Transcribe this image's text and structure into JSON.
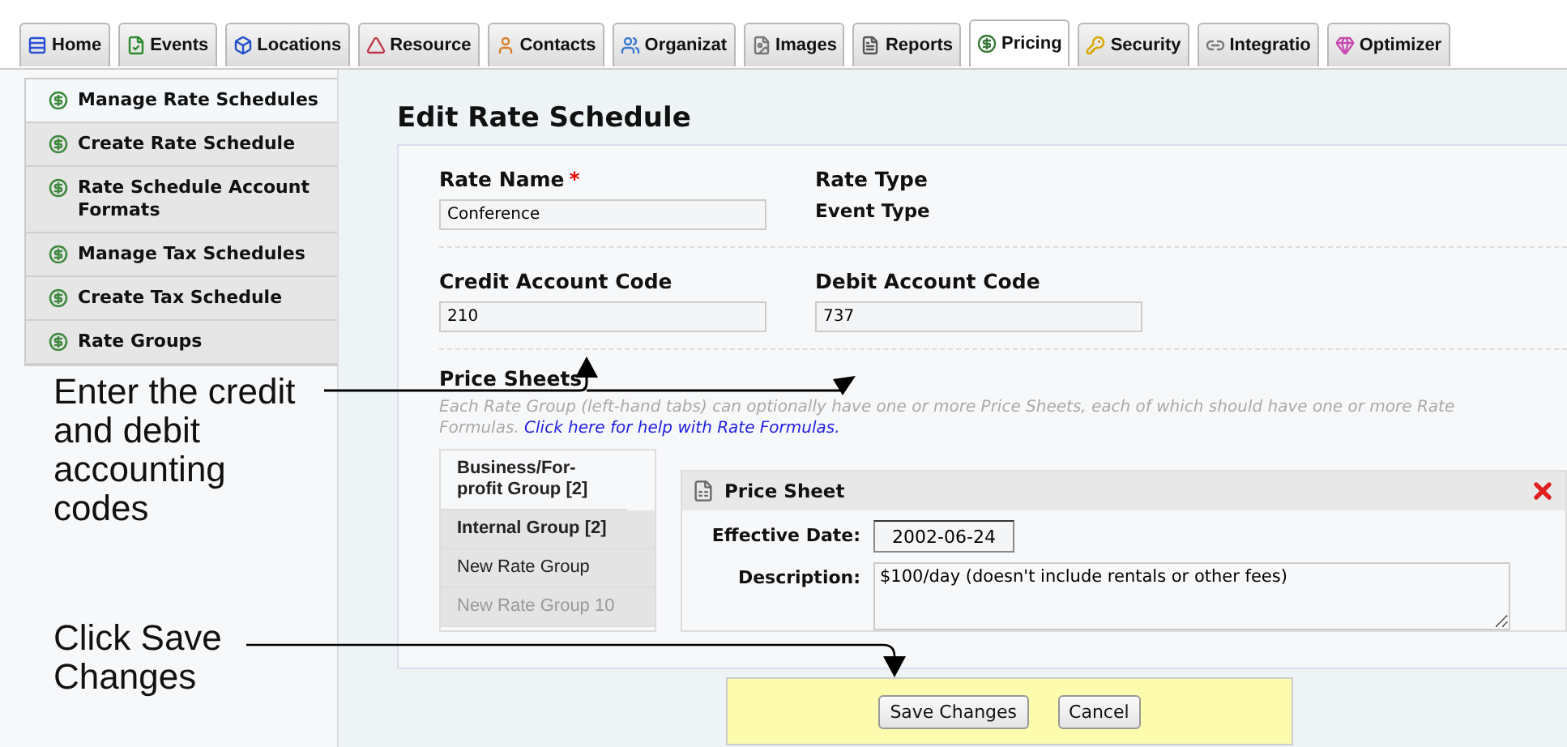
{
  "tabs": [
    {
      "label": "Home",
      "selected": false
    },
    {
      "label": "Events",
      "selected": false
    },
    {
      "label": "Locations",
      "selected": false
    },
    {
      "label": "Resource",
      "selected": false
    },
    {
      "label": "Contacts",
      "selected": false
    },
    {
      "label": "Organizat",
      "selected": false
    },
    {
      "label": "Images",
      "selected": false
    },
    {
      "label": "Reports",
      "selected": false
    },
    {
      "label": "Pricing",
      "selected": true
    },
    {
      "label": "Security",
      "selected": false
    },
    {
      "label": "Integratio",
      "selected": false
    },
    {
      "label": "Optimizer",
      "selected": false
    }
  ],
  "sidebar": {
    "items": [
      {
        "label": "Manage Rate Schedules",
        "selected": true
      },
      {
        "label": "Create Rate Schedule",
        "selected": false
      },
      {
        "label": "Rate Schedule Account Formats",
        "selected": false
      },
      {
        "label": "Manage Tax Schedules",
        "selected": false
      },
      {
        "label": "Create Tax Schedule",
        "selected": false
      },
      {
        "label": "Rate Groups",
        "selected": false
      }
    ]
  },
  "callouts": [
    "Enter the credit and debit accounting codes",
    "Click Save Changes"
  ],
  "page_title": "Edit Rate Schedule",
  "form": {
    "rate_name": {
      "label": "Rate Name",
      "required_mark": "*",
      "value": "Conference"
    },
    "rate_type": {
      "label": "Rate Type",
      "value": "Event Type"
    },
    "credit": {
      "label": "Credit Account Code",
      "value": "210"
    },
    "debit": {
      "label": "Debit Account Code",
      "value": "737"
    }
  },
  "price_sheets": {
    "title": "Price Sheets",
    "hint": "Each Rate Group (left-hand tabs) can optionally have one or more Price Sheets, each of which should have one or more Rate Formulas.",
    "help_link": "Click here for help with Rate Formulas.",
    "groups": [
      {
        "label": "Business/For-profit Group [2]",
        "selected": true,
        "disabled": false
      },
      {
        "label": "Internal Group [2]",
        "selected": false,
        "disabled": false
      },
      {
        "label": "New Rate Group",
        "selected": false,
        "disabled": false
      },
      {
        "label": "New Rate Group 10",
        "selected": false,
        "disabled": true
      }
    ],
    "sheet": {
      "title": "Price Sheet",
      "date_label": "Effective Date:",
      "date": "2002-06-24",
      "description_label": "Description:",
      "description": "$100/day (doesn't include rentals or other fees)"
    }
  },
  "buttons": [
    "Save Changes",
    "Cancel"
  ]
}
